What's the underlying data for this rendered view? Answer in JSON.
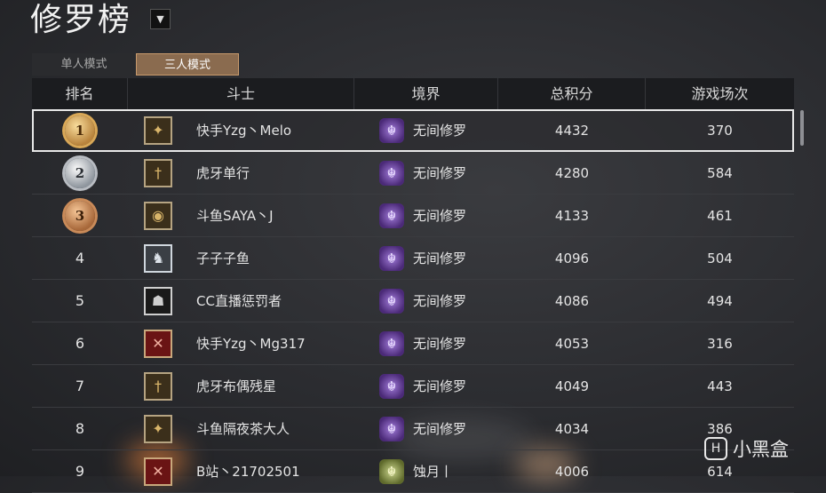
{
  "header": {
    "title": "修罗榜",
    "dropdown_icon": "▼"
  },
  "tabs": [
    {
      "label": "单人模式",
      "active": false
    },
    {
      "label": "三人模式",
      "active": true
    }
  ],
  "table": {
    "headers": [
      "排名",
      "斗士",
      "境界",
      "总积分",
      "游戏场次"
    ],
    "rows": [
      {
        "rank": "1",
        "medal": "gold",
        "avatar": "bow-icon",
        "avatar_glyph": "✦",
        "avatar_style": "av-gold",
        "name": "快手Yzg丶Melo",
        "realm_icon": "demon-purple-icon",
        "realm": "无间修罗",
        "score": "4432",
        "games": "370"
      },
      {
        "rank": "2",
        "medal": "silver",
        "avatar": "sword-icon",
        "avatar_glyph": "†",
        "avatar_style": "av-gold",
        "name": "虎牙单行",
        "realm_icon": "demon-purple-icon",
        "realm": "无间修罗",
        "score": "4280",
        "games": "584"
      },
      {
        "rank": "3",
        "medal": "bronze",
        "avatar": "shield-icon",
        "avatar_glyph": "◉",
        "avatar_style": "av-gold",
        "name": "斗鱼SAYA丶J",
        "realm_icon": "demon-purple-icon",
        "realm": "无间修罗",
        "score": "4133",
        "games": "461"
      },
      {
        "rank": "4",
        "medal": "",
        "avatar": "dragon-icon",
        "avatar_glyph": "♞",
        "avatar_style": "av-silver",
        "name": "子子子鱼",
        "realm_icon": "demon-purple-icon",
        "realm": "无间修罗",
        "score": "4096",
        "games": "504"
      },
      {
        "rank": "5",
        "medal": "",
        "avatar": "mask-icon",
        "avatar_glyph": "☗",
        "avatar_style": "av-dark",
        "name": "CC直播惩罚者",
        "realm_icon": "demon-purple-icon",
        "realm": "无间修罗",
        "score": "4086",
        "games": "494"
      },
      {
        "rank": "6",
        "medal": "",
        "avatar": "crossed-blades-icon",
        "avatar_glyph": "✕",
        "avatar_style": "av-red",
        "name": "快手Yzg丶Mg317",
        "realm_icon": "demon-purple-icon",
        "realm": "无间修罗",
        "score": "4053",
        "games": "316"
      },
      {
        "rank": "7",
        "medal": "",
        "avatar": "sword-icon",
        "avatar_glyph": "†",
        "avatar_style": "av-gold",
        "name": "虎牙布偶残星",
        "realm_icon": "demon-purple-icon",
        "realm": "无间修罗",
        "score": "4049",
        "games": "443"
      },
      {
        "rank": "8",
        "medal": "",
        "avatar": "bow-icon",
        "avatar_glyph": "✦",
        "avatar_style": "av-gold",
        "name": "斗鱼隔夜茶大人",
        "realm_icon": "demon-purple-icon",
        "realm": "无间修罗",
        "score": "4034",
        "games": "386"
      },
      {
        "rank": "9",
        "medal": "",
        "avatar": "crossed-blades-icon",
        "avatar_glyph": "✕",
        "avatar_style": "av-red",
        "name": "B站丶21702501",
        "realm_icon": "demon-green-icon",
        "realm": "蚀月丨",
        "score": "4006",
        "games": "614"
      }
    ]
  },
  "watermark": {
    "text": "小黑盒"
  }
}
